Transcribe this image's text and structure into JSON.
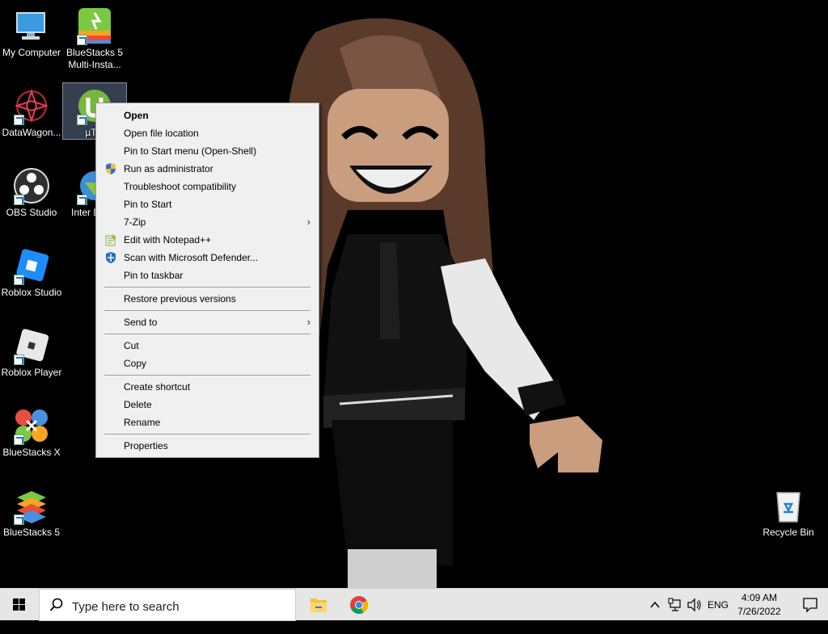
{
  "desktop": {
    "icons": [
      {
        "label": "My Computer"
      },
      {
        "label": "BlueStacks 5 Multi-Insta..."
      },
      {
        "label": "DataWagon..."
      },
      {
        "label": "µTor"
      },
      {
        "label": "OBS Studio"
      },
      {
        "label": "Inter Down"
      },
      {
        "label": "Roblox Studio"
      },
      {
        "label": "Roblox Player"
      },
      {
        "label": "BlueStacks X"
      },
      {
        "label": "BlueStacks 5"
      },
      {
        "label": "Recycle Bin"
      }
    ]
  },
  "context_menu": {
    "items": [
      {
        "label": "Open",
        "bold": true
      },
      {
        "label": "Open file location"
      },
      {
        "label": "Pin to Start menu (Open-Shell)"
      },
      {
        "label": "Run as administrator",
        "icon": "uac-shield-icon"
      },
      {
        "label": "Troubleshoot compatibility"
      },
      {
        "label": "Pin to Start"
      },
      {
        "label": "7-Zip",
        "submenu": true
      },
      {
        "label": "Edit with Notepad++",
        "icon": "notepadpp-icon"
      },
      {
        "label": "Scan with Microsoft Defender...",
        "icon": "defender-icon"
      },
      {
        "label": "Pin to taskbar"
      },
      {
        "label": "Restore previous versions"
      },
      {
        "label": "Send to",
        "submenu": true
      },
      {
        "label": "Cut"
      },
      {
        "label": "Copy"
      },
      {
        "label": "Create shortcut"
      },
      {
        "label": "Delete"
      },
      {
        "label": "Rename"
      },
      {
        "label": "Properties"
      }
    ]
  },
  "taskbar": {
    "search_placeholder": "Type here to search",
    "language": "ENG",
    "time": "4:09 AM",
    "date": "7/26/2022"
  },
  "colors": {
    "desktop_bg": "#000000",
    "menu_bg": "#f0f0f0",
    "taskbar_bg": "#e6e6e6",
    "selection": "#7f90aa"
  }
}
